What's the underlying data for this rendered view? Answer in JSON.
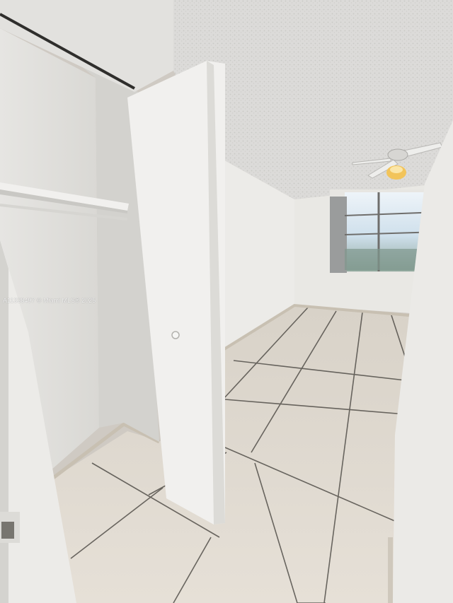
{
  "listing": {
    "watermark": "A11338497 © Miami MLS® 2025"
  },
  "scene": {
    "subject": "empty-room-with-open-closet",
    "colors": {
      "ceiling": "#dcdbd9",
      "wall": "#ebeae7",
      "closet_interior": "#e4e3e0",
      "floor_tile": "#ddd6cc",
      "grout": "#3a3835",
      "window_sky": "#d9e8f3",
      "fan_light": "#f2c45a"
    }
  }
}
